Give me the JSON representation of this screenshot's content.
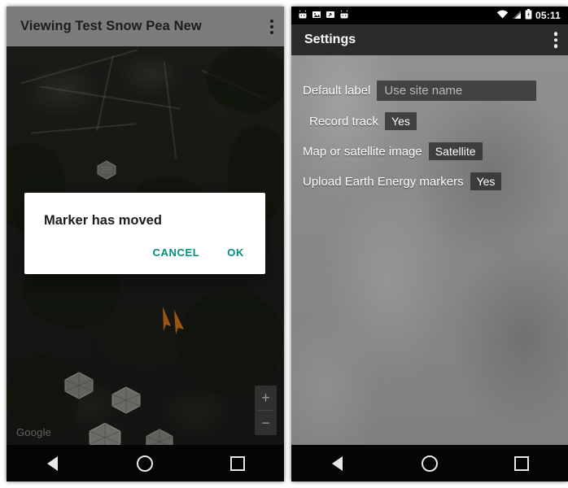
{
  "left_screen": {
    "appbar": {
      "title": "Viewing Test Snow Pea New",
      "overflow_icon": "overflow-menu-icon"
    },
    "map": {
      "attribution": "Google",
      "zoom_in_label": "+",
      "zoom_out_label": "−",
      "markers": [
        {
          "name": "blue-marker",
          "color": "#2b3fcc"
        },
        {
          "name": "orange-marker",
          "color": "#e07b1e"
        }
      ]
    },
    "dialog": {
      "title": "Marker has moved",
      "cancel_label": "CANCEL",
      "ok_label": "OK",
      "accent_color": "#009181"
    },
    "navbar": {
      "back": "back-nav",
      "home": "home-nav",
      "recents": "recents-nav"
    }
  },
  "right_screen": {
    "statusbar": {
      "icons": [
        "android-robot-icon",
        "image-icon",
        "share-upload-icon",
        "android-robot-icon"
      ],
      "wifi_icon": "wifi-icon",
      "signal_icon": "signal-icon",
      "battery_icon": "battery-icon",
      "time": "05:11"
    },
    "appbar": {
      "title": "Settings",
      "overflow_icon": "overflow-menu-icon"
    },
    "settings": [
      {
        "label": "Default label",
        "value": "",
        "placeholder": "Use site name",
        "type": "input"
      },
      {
        "label": "Record track",
        "value": "Yes",
        "type": "value"
      },
      {
        "label": "Map or satellite image",
        "value": "Satellite",
        "type": "value"
      },
      {
        "label": "Upload Earth Energy markers",
        "value": "Yes",
        "type": "value"
      }
    ],
    "navbar": {
      "back": "back-nav",
      "home": "home-nav",
      "recents": "recents-nav"
    }
  }
}
